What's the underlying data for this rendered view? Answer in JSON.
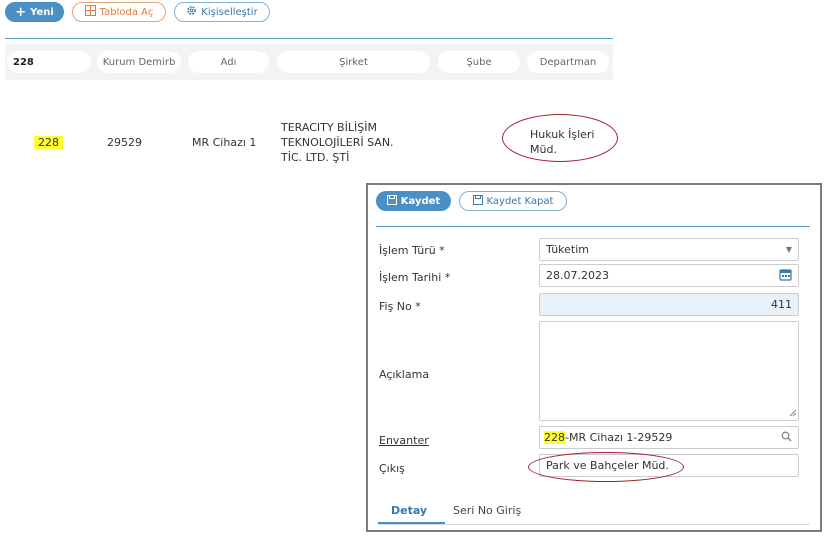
{
  "toolbar": {
    "new_label": "Yeni",
    "open_table_label": "Tabloda Aç",
    "customize_label": "Kişiselleştir"
  },
  "filters": {
    "id_value": "228",
    "columns": [
      "Kurum Demirb",
      "Adı",
      "Şirket",
      "Şube",
      "Departman"
    ]
  },
  "row": {
    "id": "228",
    "kurum_demirbas": "29529",
    "adi": "MR Cihazı 1",
    "sirket_lines": [
      "TERACITY BİLİŞİM",
      "TEKNOLOJİLERİ SAN.",
      "TİC. LTD. ŞTİ"
    ],
    "departman_lines": [
      "Hukuk İşleri",
      "Müd."
    ]
  },
  "panel": {
    "save_label": "Kaydet",
    "save_close_label": "Kaydet Kapat",
    "fields": {
      "islem_turu_label": "İşlem Türü *",
      "islem_turu_value": "Tüketim",
      "islem_tarihi_label": "İşlem Tarihi *",
      "islem_tarihi_value": "28.07.2023",
      "fis_no_label": "Fiş No *",
      "fis_no_value": "411",
      "aciklama_label": "Açıklama",
      "aciklama_value": "",
      "envanter_label": "Envanter",
      "envanter_id": "228",
      "envanter_rest": "-MR Cihazı 1-29529",
      "cikis_label": "Çıkış",
      "cikis_value": "Park ve Bahçeler Müd."
    },
    "tabs": [
      "Detay",
      "Seri No Giriş"
    ]
  },
  "colors": {
    "primary": "#4a90c4",
    "highlight": "#ffff33",
    "annotation": "#a31f2a",
    "orange": "#e07b3e"
  }
}
